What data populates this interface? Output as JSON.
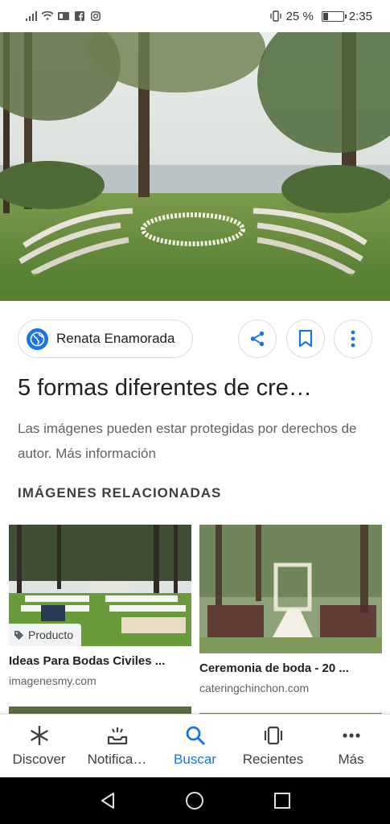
{
  "status_bar": {
    "battery_percent": "25 %",
    "time": "2:35",
    "battery_level": 0.25,
    "left_icons": [
      "signal-icon",
      "wifi-icon",
      "data-icon",
      "facebook-icon",
      "instagram-icon"
    ],
    "right_icons": [
      "vibrate-icon",
      "battery-icon"
    ]
  },
  "hero": {
    "image": "outdoor-wedding-ceremony-photo"
  },
  "source": {
    "name": "Renata Enamorada",
    "icon": "globe-icon"
  },
  "actions": {
    "share_icon": "share-icon",
    "save_icon": "bookmark-icon",
    "more_icon": "more-vert-icon"
  },
  "result": {
    "title": "5 formas diferentes de cre…",
    "notice": "Las imágenes pueden estar protegidas por derechos de autor. Más información"
  },
  "related": {
    "heading": "IMÁGENES RELACIONADAS",
    "items": [
      {
        "caption": "Ideas Para Bodas Civiles ...",
        "host": "imagenesmy.com",
        "badge": "Producto"
      },
      {
        "caption": "Ceremonia de boda - 20 ...",
        "host": "cateringchinchon.com",
        "badge": ""
      }
    ]
  },
  "bottom_nav": [
    {
      "label": "Discover",
      "icon": "asterisk-icon",
      "active": false
    },
    {
      "label": "Notifica…",
      "icon": "notifications-icon",
      "active": false
    },
    {
      "label": "Buscar",
      "icon": "search-icon",
      "active": true
    },
    {
      "label": "Recientes",
      "icon": "recents-icon",
      "active": false
    },
    {
      "label": "Más",
      "icon": "more-horiz-icon",
      "active": false
    }
  ],
  "system_nav": [
    "back-icon",
    "home-icon",
    "overview-icon"
  ],
  "colors": {
    "accent": "#1a73e8",
    "text": "#202124",
    "secondary_text": "#5f6368"
  }
}
